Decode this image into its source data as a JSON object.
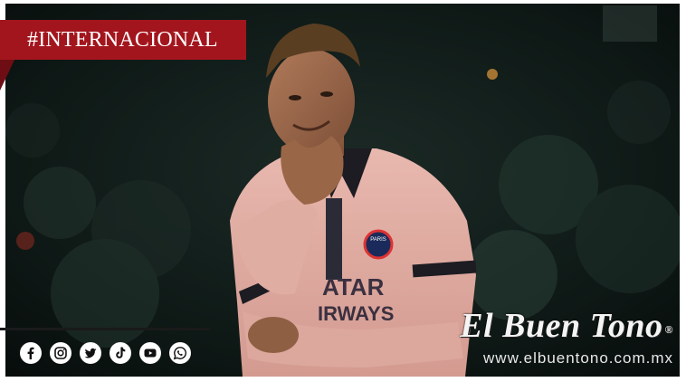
{
  "banner": {
    "label": "#INTERNACIONAL",
    "color": "#a3151d"
  },
  "photo": {
    "jersey_text_line1": "ATAR",
    "jersey_text_line2": "IRWAYS",
    "crest_text": "PARIS"
  },
  "social": {
    "icons": [
      "facebook-icon",
      "instagram-icon",
      "twitter-icon",
      "tiktok-icon",
      "youtube-icon",
      "whatsapp-icon"
    ]
  },
  "brand": {
    "name": "El Buen Tono",
    "trademark": "®",
    "url": "www.elbuentono.com.mx"
  }
}
